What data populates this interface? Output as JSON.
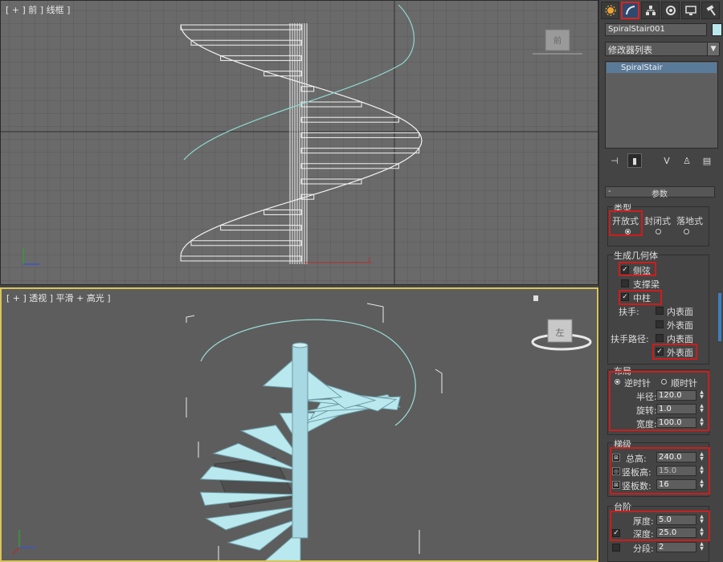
{
  "viewports": {
    "front": {
      "label": "[ + ] 前 ] 线框 ]",
      "cube_text": "前"
    },
    "perspective": {
      "label": "[ + ] 透视 ] 平滑 + 高光 ]",
      "cube_text": "左"
    }
  },
  "panel": {
    "object_name": "SpiralStair001",
    "object_color": "#b9e8ee",
    "modifier_list": "修改器列表",
    "stack_item": "SpiralStair",
    "rollout_title": "参数",
    "rollout_toggle": "-",
    "type": {
      "title": "类型",
      "options": [
        "开放式",
        "封闭式",
        "落地式"
      ],
      "selected": 0
    },
    "geometry": {
      "title": "生成几何体",
      "stringers": {
        "label": "侧弦",
        "checked": true
      },
      "carriage": {
        "label": "支撑梁",
        "checked": false
      },
      "center_pole": {
        "label": "中柱",
        "checked": true
      },
      "handrail_label": "扶手:",
      "handrail_inside": {
        "label": "内表面",
        "checked": false
      },
      "handrail_outside": {
        "label": "外表面",
        "checked": false
      },
      "rail_path_label": "扶手路径:",
      "rail_inside": {
        "label": "内表面",
        "checked": false
      },
      "rail_outside": {
        "label": "外表面",
        "checked": true
      }
    },
    "layout": {
      "title": "布局",
      "ccw": "逆时针",
      "cw": "顺时针",
      "radius_label": "半径:",
      "radius": "120.0",
      "revs_label": "旋转:",
      "revs": "1.0",
      "width_label": "宽度:",
      "width": "100.0"
    },
    "rise": {
      "title": "梯级",
      "overall_label": "总高:",
      "overall": "240.0",
      "riser_ht_label": "竖板高:",
      "riser_ht": "15.0",
      "riser_ct_label": "竖板数:",
      "riser_ct": "16"
    },
    "steps": {
      "title": "台阶",
      "thickness_label": "厚度:",
      "thickness": "5.0",
      "depth_label": "深度:",
      "depth": "25.0",
      "segs_label": "分段:",
      "segs": "2"
    }
  },
  "colors": {
    "highlight": "#d01c1c",
    "active_viewport": "#d8c45a",
    "stair": "#b9e8ee"
  }
}
